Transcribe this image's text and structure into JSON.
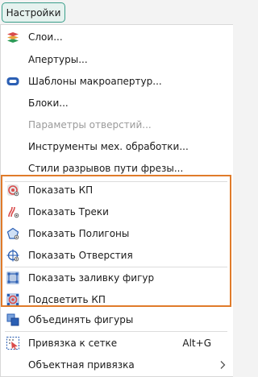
{
  "menu_button": {
    "label": "Настройки"
  },
  "items": [
    {
      "label": "Слои...",
      "icon": "layers-icon"
    },
    {
      "label": "Апертуры..."
    },
    {
      "label": "Шаблоны макроапертур...",
      "icon": "macro-aperture-icon"
    },
    {
      "label": "Блоки..."
    },
    {
      "label": "Параметры отверстий...",
      "disabled": true
    },
    {
      "label": "Инструменты мех. обработки..."
    },
    {
      "label": "Стили разрывов пути фрезы..."
    },
    {
      "label": "Показать КП",
      "icon": "show-pads-icon"
    },
    {
      "label": "Показать Треки",
      "icon": "show-tracks-icon"
    },
    {
      "label": "Показать Полигоны",
      "icon": "show-polygons-icon"
    },
    {
      "label": "Показать Отверстия",
      "icon": "show-holes-icon"
    },
    {
      "label": "Показать заливку фигур",
      "icon": "fill-shapes-icon"
    },
    {
      "label": "Подсветить КП",
      "icon": "highlight-pads-icon"
    },
    {
      "label": "Объединять фигуры",
      "icon": "merge-shapes-icon"
    },
    {
      "label": "Привязка к сетке",
      "icon": "snap-grid-icon",
      "shortcut": "Alt+G"
    },
    {
      "label": "Объектная привязка",
      "submenu": true
    }
  ],
  "colors": {
    "accent": "#3a9e8a",
    "highlight": "#e07b2a"
  }
}
